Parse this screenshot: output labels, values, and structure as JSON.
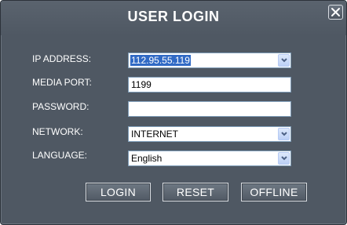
{
  "dialog": {
    "title": "USER LOGIN",
    "close_icon": "close-icon"
  },
  "form": {
    "ip_address": {
      "label": "IP ADDRESS:",
      "value": "112.95.55.119"
    },
    "media_port": {
      "label": "MEDIA PORT:",
      "value": "1199"
    },
    "password": {
      "label": "PASSWORD:",
      "value": ""
    },
    "network": {
      "label": "NETWORK:",
      "value": "INTERNET"
    },
    "language": {
      "label": "LANGUAGE:",
      "value": "English"
    }
  },
  "buttons": {
    "login": "LOGIN",
    "reset": "RESET",
    "offline": "OFFLINE"
  },
  "colors": {
    "dialog_bg": "#4f5863",
    "selection": "#316ac5",
    "field_border": "#7f9db9"
  }
}
